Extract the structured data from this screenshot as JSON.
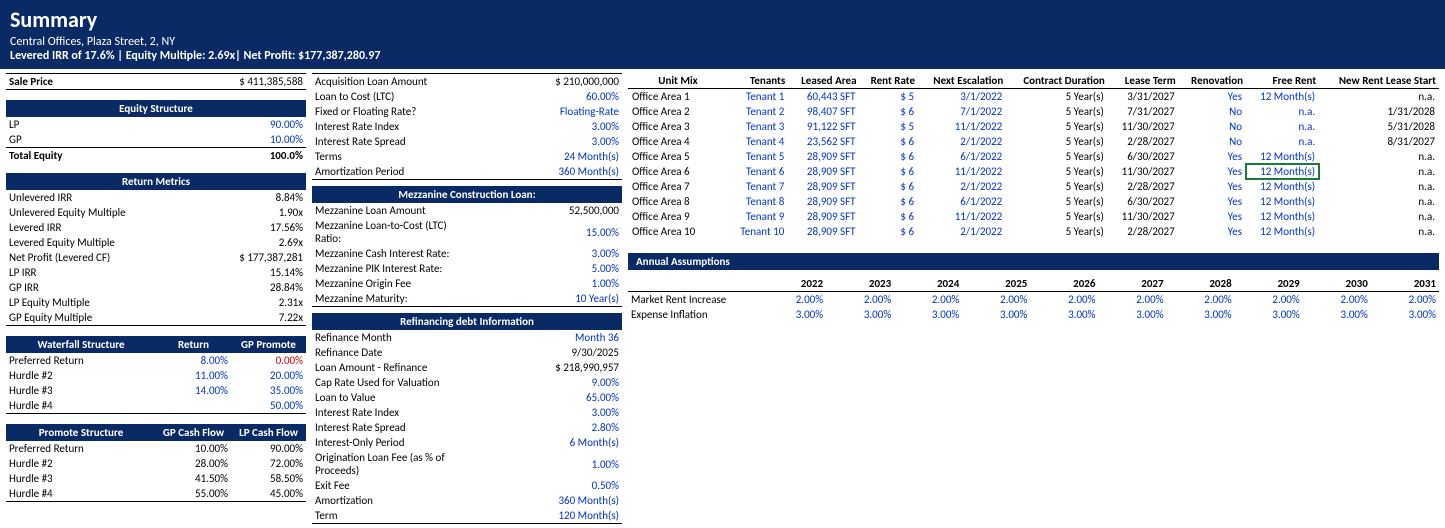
{
  "header": {
    "title": "Summary",
    "subtitle1": "Central Offices, Plaza Street, 2, NY",
    "subtitle2": "Levered IRR of 17.6% | Equity Multiple: 2.69x| Net Profit: $177,387,280.97"
  },
  "col1": {
    "sale_price_label": "Sale Price",
    "sale_price": "$ 411,385,588",
    "equity_structure_head": "Equity Structure",
    "lp_label": "LP",
    "lp": "90.00%",
    "gp_label": "GP",
    "gp": "10.00%",
    "te_label": "Total Equity",
    "te": "100.0%",
    "return_metrics_head": "Return Metrics",
    "rm": [
      {
        "l": "Unlevered IRR",
        "v": "8.84%"
      },
      {
        "l": "Unlevered Equity Multiple",
        "v": "1.90x"
      },
      {
        "l": "Levered IRR",
        "v": "17.56%"
      },
      {
        "l": "Levered Equity Multiple",
        "v": "2.69x"
      },
      {
        "l": "Net Profit (Levered CF)",
        "v": "$ 177,387,281"
      },
      {
        "l": "LP IRR",
        "v": "15.14%"
      },
      {
        "l": "GP  IRR",
        "v": "28.84%"
      },
      {
        "l": "LP Equity Multiple",
        "v": "2.31x"
      },
      {
        "l": "GP Equity Multiple",
        "v": "7.22x"
      }
    ],
    "wf_head": "Waterfall Structure",
    "wf_return": "Return",
    "wf_promote": "GP Promote",
    "wf": [
      {
        "l": "Preferred Return",
        "r": "8.00%",
        "p": "0.00%"
      },
      {
        "l": "Hurdle #2",
        "r": "11.00%",
        "p": "20.00%"
      },
      {
        "l": "Hurdle #3",
        "r": "14.00%",
        "p": "35.00%"
      },
      {
        "l": "Hurdle #4",
        "r": "",
        "p": "50.00%"
      }
    ],
    "ps_head": "Promote Structure",
    "ps_gp": "GP Cash Flow",
    "ps_lp": "LP Cash Flow",
    "ps": [
      {
        "l": "Preferred Return",
        "g": "10.00%",
        "p": "90.00%"
      },
      {
        "l": "Hurdle #2",
        "g": "28.00%",
        "p": "72.00%"
      },
      {
        "l": "Hurdle #3",
        "g": "41.50%",
        "p": "58.50%"
      },
      {
        "l": "Hurdle #4",
        "g": "55.00%",
        "p": "45.00%"
      }
    ]
  },
  "col2": {
    "acq": [
      {
        "l": "Acquisition Loan Amount",
        "v": "$ 210,000,000",
        "c": ""
      },
      {
        "l": "Loan to Cost (LTC)",
        "v": "60.00%",
        "c": "blue"
      },
      {
        "l": "Fixed or Floating Rate?",
        "v": "Floating-Rate",
        "c": "blue"
      },
      {
        "l": "Interest Rate Index",
        "v": "3.00%",
        "c": "blue"
      },
      {
        "l": "Interest Rate Spread",
        "v": "3.00%",
        "c": "blue"
      },
      {
        "l": "Terms",
        "v": "24 Month(s)",
        "c": "blue"
      },
      {
        "l": "Amortization Period",
        "v": "360 Month(s)",
        "c": "blue"
      }
    ],
    "mez_head": "Mezzanine Construction Loan:",
    "mez": [
      {
        "l": "Mezzanine Loan Amount",
        "v": "52,500,000",
        "c": ""
      },
      {
        "l": "Mezzanine Loan-to-Cost (LTC) Ratio:",
        "v": "15.00%",
        "c": "blue"
      },
      {
        "l": "Mezzanine Cash Interest Rate:",
        "v": "3.00%",
        "c": "blue"
      },
      {
        "l": "Mezzanine PIK Interest Rate:",
        "v": "5.00%",
        "c": "blue"
      },
      {
        "l": "Mezzanine Origin Fee",
        "v": "1.00%",
        "c": "blue"
      },
      {
        "l": "Mezzanine Maturity:",
        "v": "10 Year(s)",
        "c": "blue"
      }
    ],
    "refi_head": "Refinancing debt Information",
    "refi": [
      {
        "l": "Refinance Month",
        "v": "Month 36",
        "c": "blue"
      },
      {
        "l": "Refinance Date",
        "v": "9/30/2025",
        "c": ""
      },
      {
        "l": "Loan Amount - Refinance",
        "v": "$ 218,990,957",
        "c": ""
      },
      {
        "l": "Cap Rate Used for Valuation",
        "v": "9.00%",
        "c": "blue"
      },
      {
        "l": "Loan to Value",
        "v": "65.00%",
        "c": "blue"
      },
      {
        "l": "Interest Rate Index",
        "v": "3.00%",
        "c": "blue"
      },
      {
        "l": "Interest Rate Spread",
        "v": "2.80%",
        "c": "blue"
      },
      {
        "l": "Interest-Only Period",
        "v": "6 Month(s)",
        "c": "blue"
      },
      {
        "l": "Origination Loan Fee (as % of Proceeds)",
        "v": "1.00%",
        "c": "blue"
      },
      {
        "l": "Exit Fee",
        "v": "0.50%",
        "c": "blue"
      },
      {
        "l": "Amortization",
        "v": "360 Month(s)",
        "c": "blue"
      },
      {
        "l": "Term",
        "v": "120 Month(s)",
        "c": "blue"
      }
    ]
  },
  "col3": {
    "unit_head": {
      "mix": "Unit Mix",
      "tenants": "Tenants",
      "la": "Leased Area",
      "rr": "Rent Rate",
      "ne": "Next Escalation",
      "cd": "Contract Duration",
      "lt": "Lease Term",
      "ren": "Renovation",
      "fr": "Free Rent",
      "nrls": "New Rent Lease Start"
    },
    "units": [
      {
        "u": "Office Area 1",
        "t": "Tenant 1",
        "la": "60,443 SFT",
        "rr": "$ 5",
        "ne": "3/1/2022",
        "cd": "5 Year(s)",
        "lt": "3/31/2027",
        "ren": "Yes",
        "fr": "12 Month(s)",
        "nrls": "n.a."
      },
      {
        "u": "Office Area 2",
        "t": "Tenant 2",
        "la": "98,407 SFT",
        "rr": "$ 6",
        "ne": "7/1/2022",
        "cd": "5 Year(s)",
        "lt": "7/31/2027",
        "ren": "No",
        "fr": "n.a.",
        "nrls": "1/31/2028"
      },
      {
        "u": "Office Area 3",
        "t": "Tenant 3",
        "la": "91,122 SFT",
        "rr": "$ 5",
        "ne": "11/1/2022",
        "cd": "5 Year(s)",
        "lt": "11/30/2027",
        "ren": "No",
        "fr": "n.a.",
        "nrls": "5/31/2028"
      },
      {
        "u": "Office Area 4",
        "t": "Tenant 4",
        "la": "23,562 SFT",
        "rr": "$ 6",
        "ne": "2/1/2022",
        "cd": "5 Year(s)",
        "lt": "2/28/2027",
        "ren": "No",
        "fr": "n.a.",
        "nrls": "8/31/2027"
      },
      {
        "u": "Office Area 5",
        "t": "Tenant 5",
        "la": "28,909 SFT",
        "rr": "$ 6",
        "ne": "6/1/2022",
        "cd": "5 Year(s)",
        "lt": "6/30/2027",
        "ren": "Yes",
        "fr": "12 Month(s)",
        "nrls": "n.a."
      },
      {
        "u": "Office Area 6",
        "t": "Tenant 6",
        "la": "28,909 SFT",
        "rr": "$ 6",
        "ne": "11/1/2022",
        "cd": "5 Year(s)",
        "lt": "11/30/2027",
        "ren": "Yes",
        "fr": "12 Month(s)",
        "nrls": "n.a.",
        "sel": true
      },
      {
        "u": "Office Area 7",
        "t": "Tenant 7",
        "la": "28,909 SFT",
        "rr": "$ 6",
        "ne": "2/1/2022",
        "cd": "5 Year(s)",
        "lt": "2/28/2027",
        "ren": "Yes",
        "fr": "12 Month(s)",
        "nrls": "n.a."
      },
      {
        "u": "Office Area 8",
        "t": "Tenant 8",
        "la": "28,909 SFT",
        "rr": "$ 6",
        "ne": "6/1/2022",
        "cd": "5 Year(s)",
        "lt": "6/30/2027",
        "ren": "Yes",
        "fr": "12 Month(s)",
        "nrls": "n.a."
      },
      {
        "u": "Office Area 9",
        "t": "Tenant 9",
        "la": "28,909 SFT",
        "rr": "$ 6",
        "ne": "11/1/2022",
        "cd": "5 Year(s)",
        "lt": "11/30/2027",
        "ren": "Yes",
        "fr": "12 Month(s)",
        "nrls": "n.a."
      },
      {
        "u": "Office Area 10",
        "t": "Tenant 10",
        "la": "28,909 SFT",
        "rr": "$ 6",
        "ne": "2/1/2022",
        "cd": "5 Year(s)",
        "lt": "2/28/2027",
        "ren": "Yes",
        "fr": "12 Month(s)",
        "nrls": "n.a."
      }
    ],
    "assump_head": "Annual Assumptions",
    "years": [
      "2022",
      "2023",
      "2024",
      "2025",
      "2026",
      "2027",
      "2028",
      "2029",
      "2030",
      "2031"
    ],
    "assump": [
      {
        "l": "Market Rent Increase",
        "v": [
          "2.00%",
          "2.00%",
          "2.00%",
          "2.00%",
          "2.00%",
          "2.00%",
          "2.00%",
          "2.00%",
          "2.00%",
          "2.00%"
        ]
      },
      {
        "l": "Expense Inflation",
        "v": [
          "3.00%",
          "3.00%",
          "3.00%",
          "3.00%",
          "3.00%",
          "3.00%",
          "3.00%",
          "3.00%",
          "3.00%",
          "3.00%"
        ]
      }
    ]
  }
}
